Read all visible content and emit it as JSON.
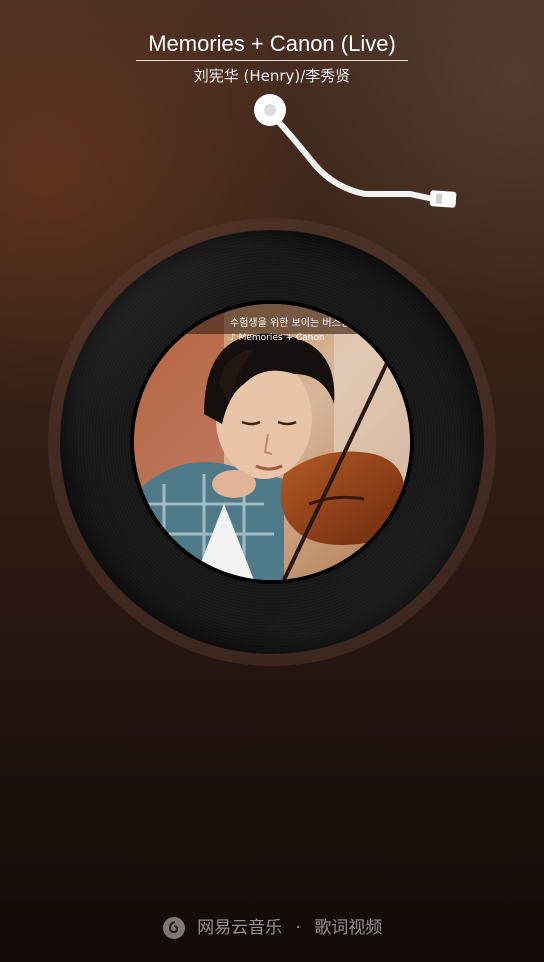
{
  "song": {
    "title": "Memories + Canon (Live)",
    "artist": "刘宪华 (Henry)/李秀贤"
  },
  "cover": {
    "banner_text": "수험생을 위한 보이는 버스킹",
    "track_text": "♪ Memories + Canon",
    "description": "Album cover: young man with dark hair playing violin, wearing plaid shirt"
  },
  "footer": {
    "brand": "网易云音乐",
    "separator": "·",
    "label": "歌词视频",
    "icon": "netease-cloud-music-logo-icon"
  },
  "colors": {
    "bg_top": "#4a2f22",
    "bg_bottom": "#120a07",
    "vinyl": "#151515",
    "text": "#ffffff"
  }
}
